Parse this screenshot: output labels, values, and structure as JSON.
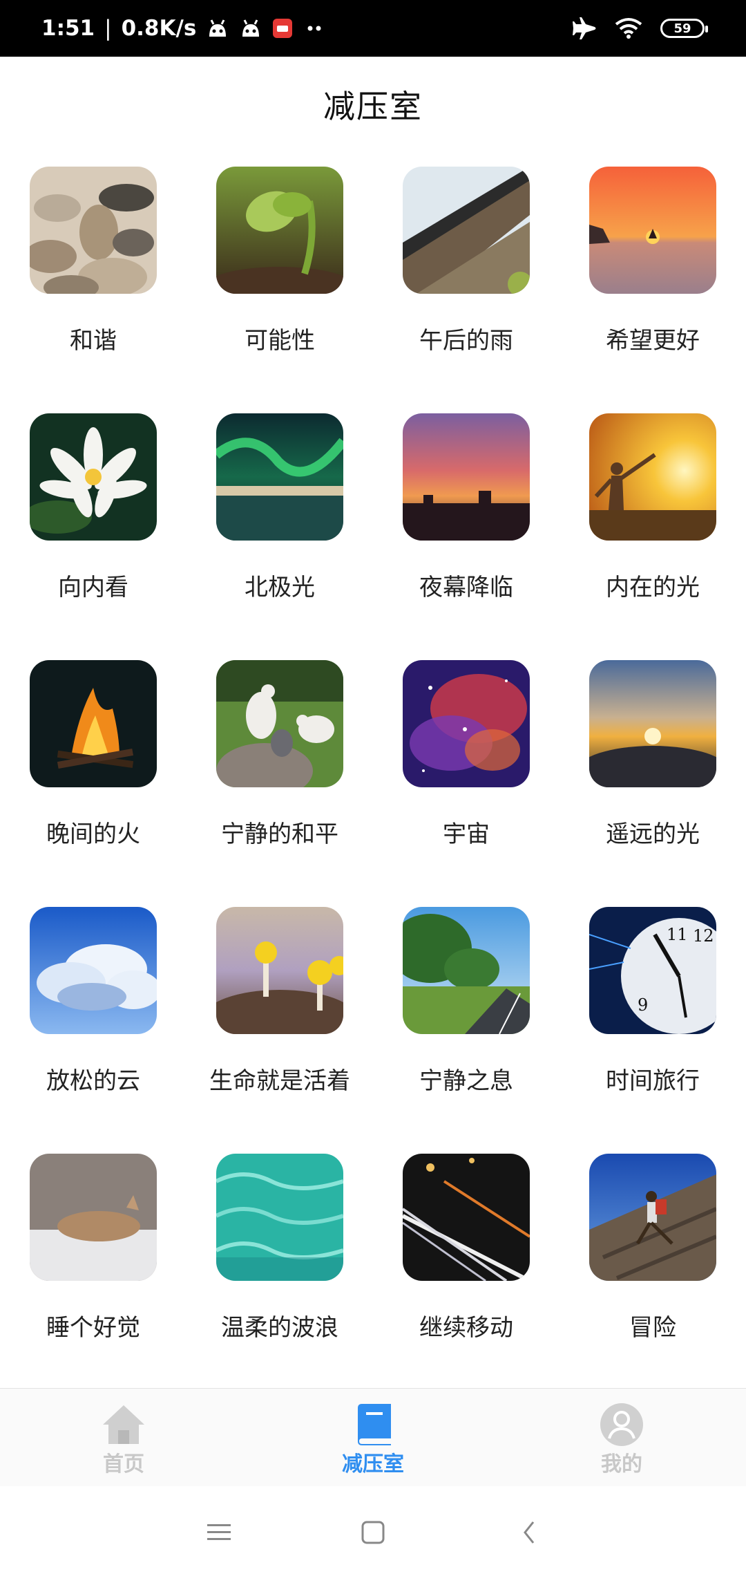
{
  "status_bar": {
    "time": "1:51",
    "net_speed": "0.8K/s",
    "battery": "59",
    "icons": [
      "android-icon",
      "android-icon",
      "app-notification-icon",
      "more-dots-icon",
      "airplane-icon",
      "wifi-icon",
      "battery-icon"
    ]
  },
  "page": {
    "title": "减压室"
  },
  "items": [
    {
      "label": "和谐",
      "icon": "stones-image"
    },
    {
      "label": "可能性",
      "icon": "sprout-image"
    },
    {
      "label": "午后的雨",
      "icon": "roof-image"
    },
    {
      "label": "希望更好",
      "icon": "sunset-sea-image"
    },
    {
      "label": "向内看",
      "icon": "water-lily-image"
    },
    {
      "label": "北极光",
      "icon": "aurora-image"
    },
    {
      "label": "夜幕降临",
      "icon": "dusk-city-image"
    },
    {
      "label": "内在的光",
      "icon": "sunrise-person-image"
    },
    {
      "label": "晚间的火",
      "icon": "campfire-image"
    },
    {
      "label": "宁静的和平",
      "icon": "doves-image"
    },
    {
      "label": "宇宙",
      "icon": "nebula-image"
    },
    {
      "label": "遥远的光",
      "icon": "sunrise-clouds-image"
    },
    {
      "label": "放松的云",
      "icon": "clouds-image"
    },
    {
      "label": "生命就是活着",
      "icon": "mushrooms-image"
    },
    {
      "label": "宁静之息",
      "icon": "road-trees-image"
    },
    {
      "label": "时间旅行",
      "icon": "clock-image"
    },
    {
      "label": "睡个好觉",
      "icon": "sleeping-cat-image"
    },
    {
      "label": "温柔的波浪",
      "icon": "water-image"
    },
    {
      "label": "继续移动",
      "icon": "light-trails-image"
    },
    {
      "label": "冒险",
      "icon": "climber-image"
    }
  ],
  "bottom_nav": {
    "home": "首页",
    "relax": "减压室",
    "mine": "我的",
    "active": "relax",
    "active_color": "#2f8ef0",
    "inactive_color": "#c8c8c8"
  },
  "system_nav": [
    "menu-icon",
    "home-icon",
    "back-icon"
  ]
}
